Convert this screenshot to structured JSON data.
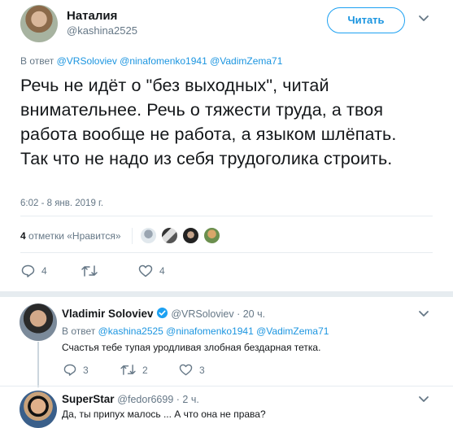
{
  "tweet": {
    "author_name": "Наталия",
    "author_handle": "@kashina2525",
    "follow_label": "Читать",
    "reply_prefix": "В ответ",
    "reply_mentions": "@VRSoloviev @ninafomenko1941 @VadimZema71",
    "text": "Речь не идёт о \"без выходных\", читай внимательнее. Речь о тяжести труда, а твоя работа вообще не работа, а языком шлёпать. Так что не надо из себя трудоголика строить.",
    "timestamp": "6:02 - 8 янв. 2019 г.",
    "likes_count": "4",
    "likes_label": "отметки «Нравится»",
    "reply_count": "4",
    "retweet_count": "",
    "like_count": "4"
  },
  "replies": [
    {
      "name": "Vladimir Soloviev",
      "handle": "@VRSoloviev · 20 ч.",
      "reply_prefix": "В ответ",
      "reply_mentions": "@kashina2525 @ninafomenko1941 @VadimZema71",
      "text": "Счастья тебе тупая уродливая злобная бездарная тетка.",
      "reply_count": "3",
      "retweet_count": "2",
      "like_count": "3"
    },
    {
      "name": "SuperStar",
      "handle": "@fedor6699 · 2 ч.",
      "text": "Да, ты припух малось ...  А что она не права?"
    }
  ],
  "colors": {
    "accent": "#1b95e0",
    "secondary_text": "#657786",
    "border": "#e6ecf0"
  },
  "icons": [
    "chevron-down-icon",
    "reply-icon",
    "retweet-icon",
    "heart-icon",
    "verified-icon"
  ]
}
